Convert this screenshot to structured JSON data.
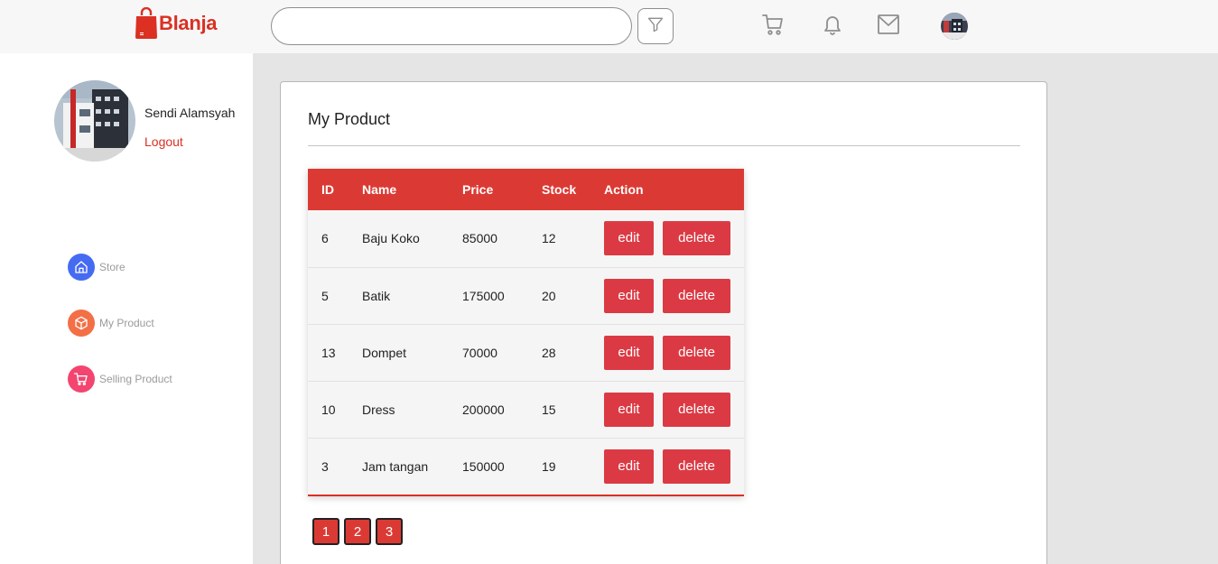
{
  "brand": {
    "name": "Blanja",
    "color": "#db3022"
  },
  "search": {
    "value": "",
    "placeholder": ""
  },
  "icons": [
    "filter-icon",
    "cart-icon",
    "bell-icon",
    "mail-icon"
  ],
  "user": {
    "name": "Sendi Alamsyah",
    "logout_label": "Logout"
  },
  "sidebar": {
    "items": [
      {
        "label": "Store",
        "icon": "home-icon",
        "color": "#456bf3"
      },
      {
        "label": "My Product",
        "icon": "package-icon",
        "color": "#f36f45"
      },
      {
        "label": "Selling Product",
        "icon": "cart-icon",
        "color": "#f3456f"
      }
    ]
  },
  "main": {
    "title": "My Product",
    "table": {
      "headers": [
        "ID",
        "Name",
        "Price",
        "Stock",
        "Action"
      ],
      "rows": [
        {
          "id": "6",
          "name": "Baju Koko",
          "price": "85000",
          "stock": "12"
        },
        {
          "id": "5",
          "name": "Batik",
          "price": "175000",
          "stock": "20"
        },
        {
          "id": "13",
          "name": "Dompet",
          "price": "70000",
          "stock": "28"
        },
        {
          "id": "10",
          "name": "Dress",
          "price": "200000",
          "stock": "15"
        },
        {
          "id": "3",
          "name": "Jam tangan",
          "price": "150000",
          "stock": "19"
        }
      ],
      "edit_label": "edit",
      "delete_label": "delete"
    },
    "pagination": [
      "1",
      "2",
      "3"
    ]
  }
}
